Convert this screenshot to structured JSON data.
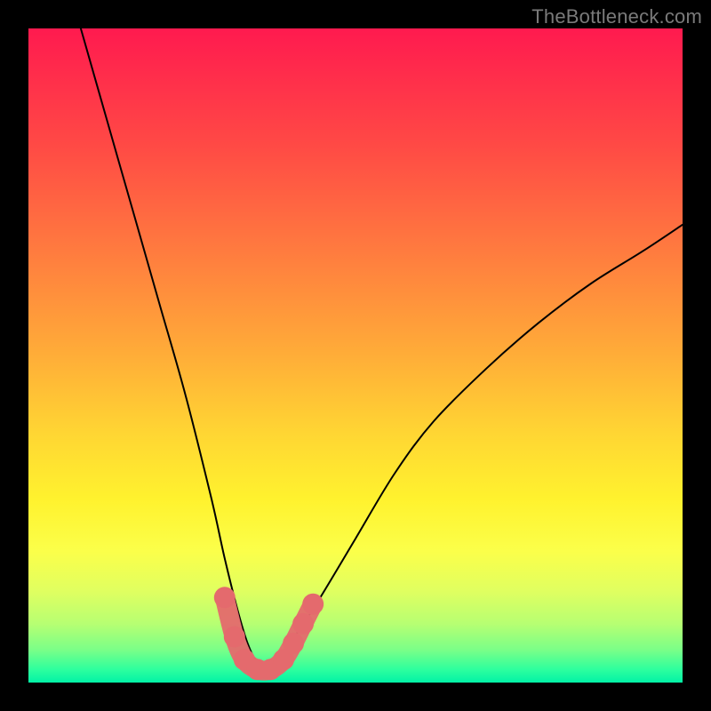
{
  "watermark": "TheBottleneck.com",
  "colors": {
    "frame_bg_top": "#ff1a4f",
    "frame_bg_bottom": "#02f2a6",
    "curve": "#000000",
    "marker": "#e46a6d",
    "page_bg": "#000000",
    "watermark": "#7a7a7a"
  },
  "chart_data": {
    "type": "line",
    "title": "",
    "xlabel": "",
    "ylabel": "",
    "xlim": [
      0,
      100
    ],
    "ylim": [
      0,
      100
    ],
    "note": "Axes are unlabeled; x/y are normalized 0–100 to the plot frame (origin bottom-left).",
    "series": [
      {
        "name": "bottleneck-curve",
        "x": [
          8,
          12,
          16,
          20,
          24,
          28,
          30,
          32,
          33.5,
          35,
          36.5,
          38,
          40,
          44,
          50,
          56,
          62,
          70,
          78,
          86,
          94,
          100
        ],
        "y": [
          100,
          86,
          72,
          58,
          44,
          28,
          19,
          11,
          6,
          3,
          2,
          3,
          6,
          12,
          22,
          32,
          40,
          48,
          55,
          61,
          66,
          70
        ]
      }
    ],
    "markers": {
      "name": "highlighted-points",
      "x": [
        30.0,
        31.5,
        33.0,
        35.0,
        37.0,
        39.0,
        40.5,
        42.0,
        43.5
      ],
      "y": [
        13.0,
        7.0,
        3.5,
        2.0,
        2.0,
        3.5,
        6.0,
        9.0,
        12.0
      ]
    }
  }
}
